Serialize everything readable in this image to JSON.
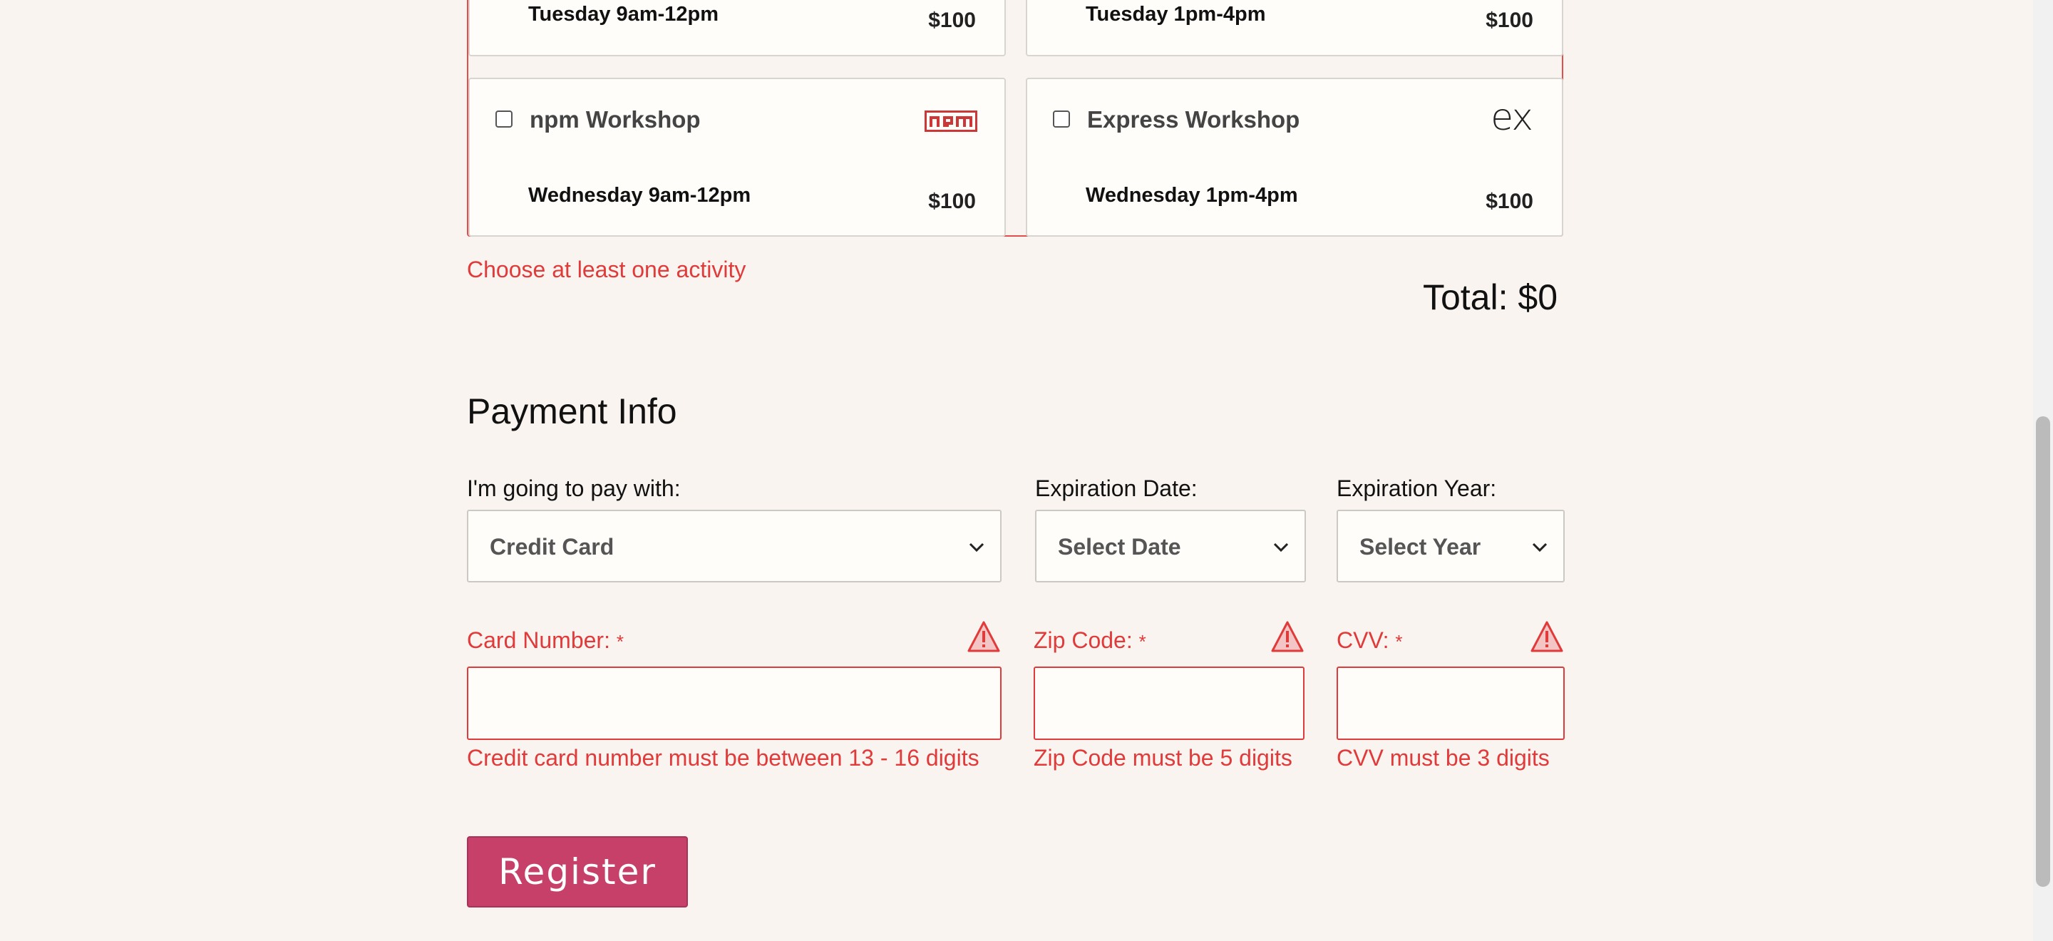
{
  "activities": {
    "top_left": {
      "time": "Tuesday 9am-12pm",
      "price": "$100"
    },
    "top_right": {
      "time": "Tuesday 1pm-4pm",
      "price": "$100"
    },
    "npm": {
      "name": "npm Workshop",
      "time": "Wednesday 9am-12pm",
      "price": "$100",
      "icon": "npm-logo-icon"
    },
    "express": {
      "name": "Express Workshop",
      "time": "Wednesday 1pm-4pm",
      "price": "$100",
      "icon_text": "ex",
      "icon": "express-logo-icon"
    },
    "error": "Choose at least one activity",
    "total": "Total: $0"
  },
  "payment": {
    "title": "Payment Info",
    "pay_with_label": "I'm going to pay with:",
    "pay_with_value": "Credit Card",
    "exp_date_label": "Expiration Date:",
    "exp_date_value": "Select Date",
    "exp_year_label": "Expiration Year:",
    "exp_year_value": "Select Year",
    "card_number_label": "Card Number:",
    "zip_label": "Zip Code:",
    "cvv_label": "CVV:",
    "required_mark": "*",
    "card_number_error": "Credit card number must be between 13 - 16 digits",
    "zip_error": "Zip Code must be 5 digits",
    "cvv_error": "CVV must be 3 digits"
  },
  "register_label": "Register",
  "colors": {
    "error": "#e03a3a",
    "accent": "#c7406a",
    "background": "#f9f4ef"
  }
}
